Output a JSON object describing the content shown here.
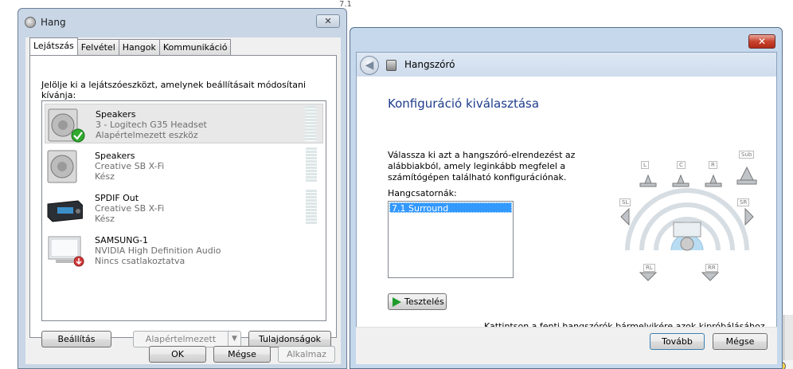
{
  "background": {
    "top_right_text": "7.1"
  },
  "hang": {
    "title": "Hang",
    "close_label": "✕",
    "tabs": [
      "Lejátszás",
      "Felvétel",
      "Hangok",
      "Kommunikáció"
    ],
    "instruction": "Jelölje ki a lejátszóeszközt, amelynek beállításait módosítani kívánja:",
    "devices": [
      {
        "name": "Speakers",
        "line1": "3 - Logitech G35 Headset",
        "line2": "Alapértelmezett eszköz",
        "icon": "speaker-icon",
        "status_icon": "default-check-icon"
      },
      {
        "name": "Speakers",
        "line1": "Creative SB X-Fi",
        "line2": "Kész",
        "icon": "speaker-icon"
      },
      {
        "name": "SPDIF Out",
        "line1": "Creative SB X-Fi",
        "line2": "Kész",
        "icon": "spdif-device-icon"
      },
      {
        "name": "SAMSUNG-1",
        "line1": "NVIDIA High Definition Audio",
        "line2": "Nincs csatlakoztatva",
        "icon": "monitor-icon",
        "status_icon": "disconnected-icon"
      }
    ],
    "buttons": {
      "configure": "Beállítás",
      "set_default": "Alapértelmezett",
      "properties": "Tulajdonságok",
      "ok": "OK",
      "cancel": "Mégse",
      "apply": "Alkalmaz"
    }
  },
  "wizard": {
    "title": "Hangszóró",
    "close_label": "✕",
    "heading": "Konfiguráció kiválasztása",
    "description": "Válassza ki azt a hangszóró-elrendezést az alábbiakból, amely leginkább megfelel a számítógépen található konfigurációnak.",
    "channels_label": "Hangcsatornák:",
    "channels": [
      "7.1 Surround"
    ],
    "test_button": "Tesztelés",
    "hint": "Kattintson a fenti hangszórók bármelyikére azok kipróbálásához.",
    "speaker_labels": {
      "L": "L",
      "C": "C",
      "R": "R",
      "Sub": "Sub",
      "SL": "SL",
      "SR": "SR",
      "RL": "RL",
      "RR": "RR"
    },
    "next_button": "Tovább",
    "cancel_button": "Mégse"
  }
}
